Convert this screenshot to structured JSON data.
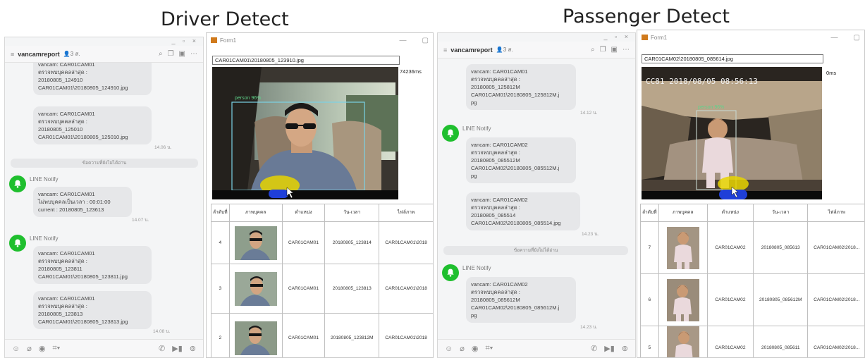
{
  "headings": {
    "driver": "Driver Detect",
    "passenger": "Passenger Detect"
  },
  "colors": {
    "line_green": "#1fbf2e",
    "bubble": "#e6e7e9",
    "detect_box": "#7bd3e6",
    "pointer_yellow": "#e6d400",
    "pointer_blue": "#1f3fd8"
  },
  "left_chat": {
    "title": "vancamreport",
    "members": "3",
    "badge": "ส.",
    "window_controls": "_ ▫ ×",
    "messages": [
      {
        "text": "vancam: CAR01CAM01\nตรวจพบบุคคลล่าสุด :\n20180805_124910\nCAR01CAM01\\20180805_124910.jpg"
      },
      {
        "text": "vancam: CAR01CAM01\nตรวจพบบุคคลล่าสุด :\n20180805_125010\nCAR01CAM01\\20180805_125010.jpg",
        "time": "14.06 น."
      },
      {
        "divider": "ข้อความที่ยังไม่ได้อ่าน"
      },
      {
        "sender": "LINE Notify",
        "text": "vancam: CAR01CAM01\nไม่พบบุคคลเป็นเวลา : 00:01:00\ncurrent : 20180805_123613",
        "time": "14.07 น."
      },
      {
        "sender": "LINE Notify",
        "text": "vancam: CAR01CAM01\nตรวจพบบุคคลล่าสุด :\n20180805_123811\nCAR01CAM01\\20180805_123811.jpg"
      },
      {
        "text": "vancam: CAR01CAM01\nตรวจพบบุคคลล่าสุด :\n20180805_123813\nCAR01CAM01\\20180805_123813.jpg",
        "time": "14.08 น."
      }
    ]
  },
  "right_chat": {
    "title": "vancamreport",
    "members": "3",
    "badge": "ส.",
    "window_controls": "_ ▫ ×",
    "messages": [
      {
        "text": "vancam: CAR01CAM01\nตรวจพบบุคคลล่าสุด :\n20180805_125812M\nCAR01CAM01\\20180805_125812M.j\npg",
        "time": "14.12 น."
      },
      {
        "sender": "LINE Notify",
        "text": "vancam: CAR01CAM02\nตรวจพบบุคคลล่าสุด :\n20180805_085512M\nCAR01CAM02\\20180805_085512M.j\npg"
      },
      {
        "text": "vancam: CAR01CAM02\nตรวจพบบุคคลล่าสุด :\n20180805_085514\nCAR01CAM02\\20180805_085514.jpg",
        "time": "14.23 น."
      },
      {
        "divider": "ข้อความที่ยังไม่ได้อ่าน"
      },
      {
        "sender": "LINE Notify",
        "text": "vancam: CAR01CAM02\nตรวจพบบุคคลล่าสุด :\n20180805_085612M\nCAR01CAM02\\20180805_085612M.j\npg",
        "time": "14.23 น."
      }
    ]
  },
  "driver_form": {
    "title": "Form1",
    "path": "CAR01CAM01\\20180805_123910.jpg",
    "elapsed": "74236ms",
    "cam_label": "person 96%",
    "headers": [
      "ลำดับที่",
      "ภาพบุคคล",
      "ตำแหน่ง",
      "วัน-เวลา",
      "ไฟล์ภาพ"
    ],
    "rows": [
      {
        "no": "4",
        "cam": "CAR01CAM01",
        "datetime": "20180805_123814",
        "file": "CAR01CAM01\\2018"
      },
      {
        "no": "3",
        "cam": "CAR01CAM01",
        "datetime": "20180805_123813",
        "file": "CAR01CAM01\\2018"
      },
      {
        "no": "2",
        "cam": "CAR01CAM01",
        "datetime": "20180805_123812M",
        "file": "CAR01CAM01\\2018"
      }
    ]
  },
  "passenger_form": {
    "title": "Form1",
    "path": "CAR01CAM02\\20180805_085614.jpg",
    "elapsed": "0ms",
    "overlay": "CC81 2018/08/05 08:56:13",
    "cam_label": "person 96%",
    "headers": [
      "ลำดับที่",
      "ภาพบุคคล",
      "ตำแหน่ง",
      "วัน-เวลา",
      "ไฟล์ภาพ"
    ],
    "rows": [
      {
        "no": "7",
        "cam": "CAR01CAM02",
        "datetime": "20180805_085613",
        "file": "CAR01CAM02\\2018..."
      },
      {
        "no": "6",
        "cam": "CAR01CAM02",
        "datetime": "20180805_085612M",
        "file": "CAR01CAM02\\2018..."
      },
      {
        "no": "5",
        "cam": "CAR01CAM02",
        "datetime": "20180805_085611",
        "file": "CAR01CAM02\\2018..."
      }
    ]
  }
}
